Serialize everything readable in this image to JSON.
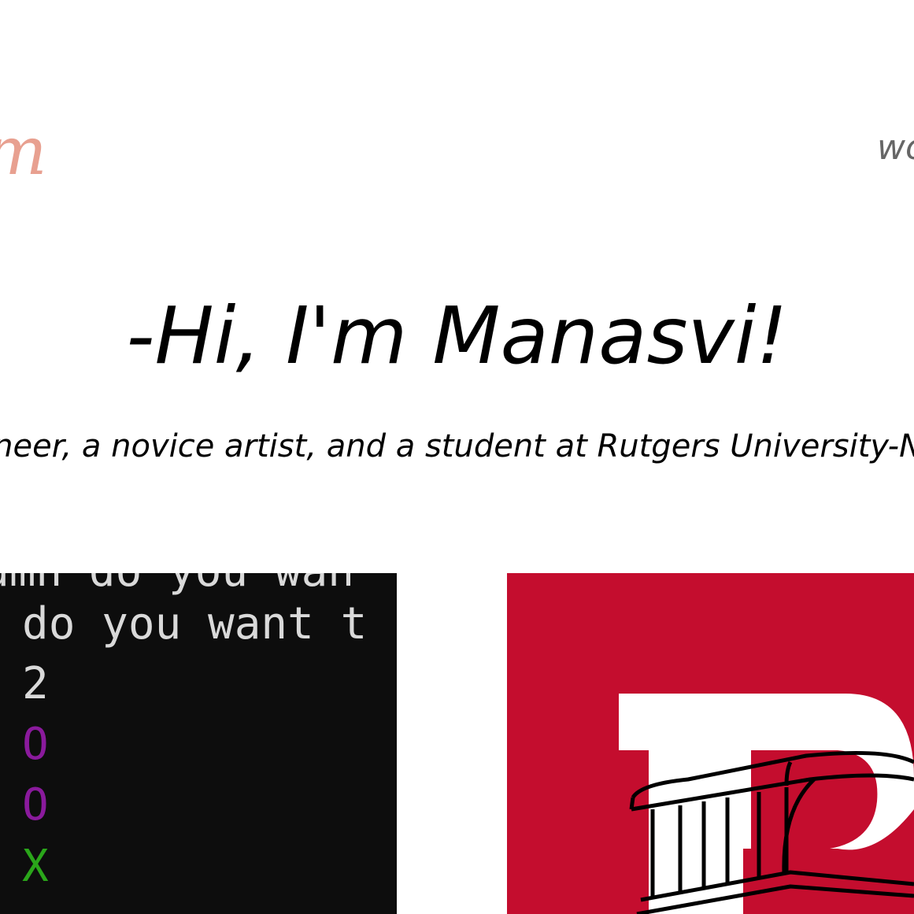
{
  "header": {
    "logo_text": "m",
    "nav_link_text": "wo"
  },
  "hero": {
    "title": "-Hi, I'm Manasvi!",
    "subtitle": "ineer, a novice artist, and a student at Rutgers University-N"
  },
  "projects": {
    "terminal": {
      "cut_line": "umn do you wan",
      "lines": [
        "do you want t",
        "2",
        "O",
        "O",
        "X"
      ]
    },
    "rutgers": {
      "logo_icon": "rutgers-r-bus-icon"
    }
  },
  "colors": {
    "logo": "#e8a090",
    "nav": "#666666",
    "terminal_bg": "#0d0d0d",
    "terminal_text": "#d9d9d9",
    "terminal_o": "#8a1a9c",
    "terminal_x": "#2aa61a",
    "rutgers_red": "#c40d2e"
  }
}
